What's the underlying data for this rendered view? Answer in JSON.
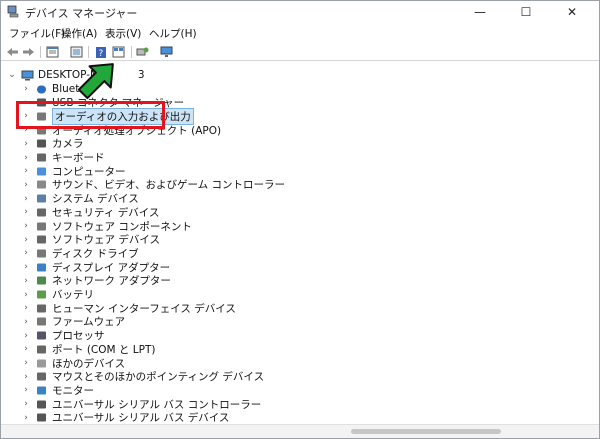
{
  "window": {
    "title": "デバイス マネージャー",
    "minimize_glyph": "—",
    "maximize_glyph": "☐",
    "close_glyph": "✕"
  },
  "menu": [
    "ファイル(F)",
    "操作(A)",
    "表示(V)",
    "ヘルプ(H)"
  ],
  "toolbar_icons": [
    "back-icon",
    "forward-icon",
    "properties-icon",
    "update-driver-icon",
    "help-icon",
    "view-icon",
    "scan-hardware-icon",
    "monitor-icon"
  ],
  "tree": {
    "root": "DESKTOP-N",
    "root_suffix": "3",
    "items": [
      {
        "label": "Blueto",
        "icon": "bluetooth-icon"
      },
      {
        "label": "USB コネクタ マネージャー",
        "icon": "usb-connector-icon"
      },
      {
        "label": "オーディオの入力および出力",
        "icon": "audio-icon",
        "selected": true
      },
      {
        "label": "オーディオ処理オブジェクト (APO)",
        "icon": "audio-processing-icon"
      },
      {
        "label": "カメラ",
        "icon": "camera-icon"
      },
      {
        "label": "キーボード",
        "icon": "keyboard-icon"
      },
      {
        "label": "コンピューター",
        "icon": "computer-icon"
      },
      {
        "label": "サウンド、ビデオ、およびゲーム コントローラー",
        "icon": "sound-icon"
      },
      {
        "label": "システム デバイス",
        "icon": "system-device-icon"
      },
      {
        "label": "セキュリティ デバイス",
        "icon": "security-icon"
      },
      {
        "label": "ソフトウェア コンポーネント",
        "icon": "software-component-icon"
      },
      {
        "label": "ソフトウェア デバイス",
        "icon": "software-device-icon"
      },
      {
        "label": "ディスク ドライブ",
        "icon": "disk-drive-icon"
      },
      {
        "label": "ディスプレイ アダプター",
        "icon": "display-adapter-icon"
      },
      {
        "label": "ネットワーク アダプター",
        "icon": "network-adapter-icon"
      },
      {
        "label": "バッテリ",
        "icon": "battery-icon"
      },
      {
        "label": "ヒューマン インターフェイス デバイス",
        "icon": "hid-icon"
      },
      {
        "label": "ファームウェア",
        "icon": "firmware-icon"
      },
      {
        "label": "プロセッサ",
        "icon": "processor-icon"
      },
      {
        "label": "ポート (COM と LPT)",
        "icon": "port-icon"
      },
      {
        "label": "ほかのデバイス",
        "icon": "other-device-icon"
      },
      {
        "label": "マウスとそのほかのポインティング デバイス",
        "icon": "mouse-icon"
      },
      {
        "label": "モニター",
        "icon": "monitor-icon"
      },
      {
        "label": "ユニバーサル シリアル バス コントローラー",
        "icon": "usb-controller-icon"
      },
      {
        "label": "ユニバーサル シリアル バス デバイス",
        "icon": "usb-device-icon"
      }
    ]
  },
  "colors": {
    "highlight_red": "#e3141c",
    "arrow_green": "#22a83a",
    "selection": "#cce4f7"
  }
}
